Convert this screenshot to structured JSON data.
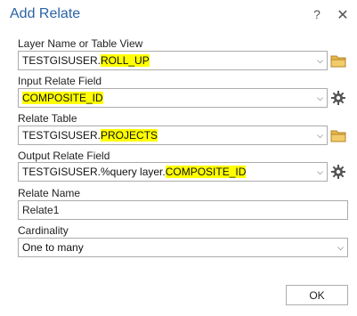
{
  "window": {
    "title": "Add Relate",
    "help_glyph": "?",
    "close_glyph": "✕"
  },
  "fields": {
    "layer_name": {
      "label": "Layer Name or Table View",
      "value_prefix": "TESTGISUSER.",
      "value_highlight": "ROLL_UP",
      "icon": "folder-icon"
    },
    "input_relate_field": {
      "label": "Input Relate Field",
      "value_highlight": "COMPOSITE_ID",
      "icon": "gear-icon"
    },
    "relate_table": {
      "label": "Relate Table",
      "value_prefix": "TESTGISUSER.",
      "value_highlight": "PROJECTS",
      "icon": "folder-icon"
    },
    "output_relate_field": {
      "label": "Output Relate Field",
      "value_prefix": "TESTGISUSER.%query layer.",
      "value_highlight": "COMPOSITE_ID",
      "icon": "gear-icon"
    },
    "relate_name": {
      "label": "Relate Name",
      "value": "Relate1"
    },
    "cardinality": {
      "label": "Cardinality",
      "value": "One to many"
    }
  },
  "buttons": {
    "ok_label": "OK"
  },
  "colors": {
    "title": "#2a63a6",
    "highlight": "#ffff00",
    "folder": "#d9a53a",
    "gear": "#555555"
  }
}
